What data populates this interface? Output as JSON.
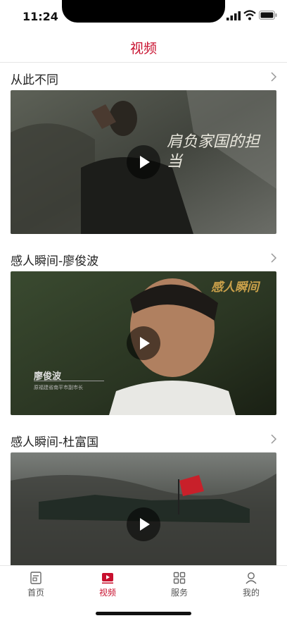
{
  "status": {
    "time": "11:24"
  },
  "header": {
    "title": "视频"
  },
  "sections": [
    {
      "title": "从此不同",
      "overlay_text": "肩负家国的担当",
      "thumb_colors": [
        "#4d5248",
        "#2c2f29"
      ]
    },
    {
      "title": "感人瞬间-廖俊波",
      "overlay_title": "感人瞬间",
      "name_tag": "廖俊波",
      "name_sub": "原福建省南平市副市长",
      "thumb_colors": [
        "#3d4a33",
        "#1e2418"
      ]
    },
    {
      "title": "感人瞬间-杜富国",
      "thumb_colors": [
        "#5a5f5c",
        "#383a36"
      ]
    }
  ],
  "tabbar": {
    "items": [
      {
        "label": "首页",
        "icon": "home-icon"
      },
      {
        "label": "视频",
        "icon": "video-icon"
      },
      {
        "label": "服务",
        "icon": "grid-icon"
      },
      {
        "label": "我的",
        "icon": "user-icon"
      }
    ],
    "active_color": "#c8102e"
  }
}
